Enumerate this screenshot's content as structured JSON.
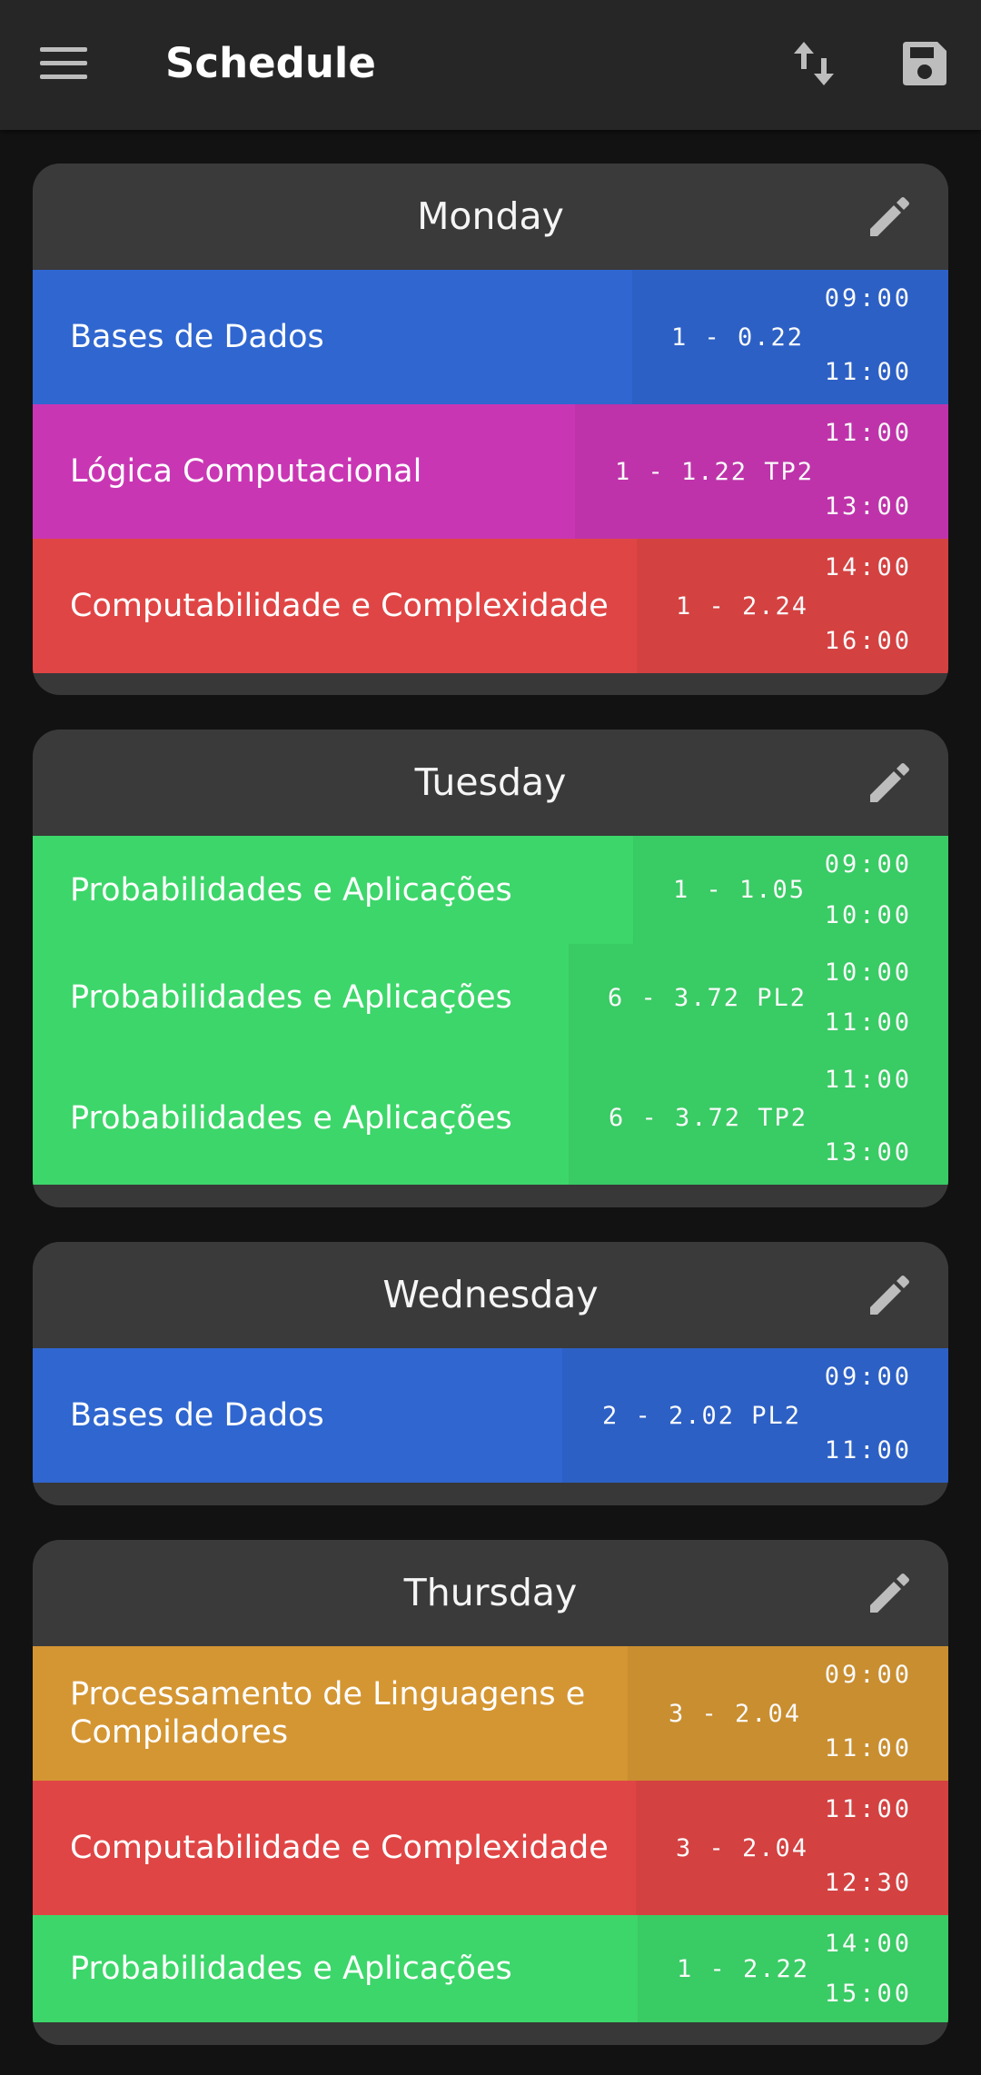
{
  "appbar": {
    "title": "Schedule",
    "menu_icon": "menu-icon",
    "sort_icon": "swap-vertical-icon",
    "save_icon": "save-icon"
  },
  "colors": {
    "blue": "#2f66d0",
    "magenta": "#c936b4",
    "red": "#e04545",
    "green": "#3dd66a",
    "orange": "#d49633"
  },
  "days": [
    {
      "name": "Monday",
      "lessons": [
        {
          "subject": "Bases de Dados",
          "room": "1 - 0.22",
          "start": "09:00",
          "end": "11:00"
        },
        {
          "subject": "Lógica Computacional",
          "room": "1 - 1.22 TP2",
          "start": "11:00",
          "end": "13:00"
        },
        {
          "subject": "Computabilidade e Complexidade",
          "room": "1 - 2.24",
          "start": "14:00",
          "end": "16:00"
        }
      ]
    },
    {
      "name": "Tuesday",
      "lessons": [
        {
          "subject": "Probabilidades e Aplicações",
          "room": "1 - 1.05",
          "start": "09:00",
          "end": "10:00"
        },
        {
          "subject": "Probabilidades e Aplicações",
          "room": "6 - 3.72 PL2",
          "start": "10:00",
          "end": "11:00"
        },
        {
          "subject": "Probabilidades e Aplicações",
          "room": "6 - 3.72 TP2",
          "start": "11:00",
          "end": "13:00"
        }
      ]
    },
    {
      "name": "Wednesday",
      "lessons": [
        {
          "subject": "Bases de Dados",
          "room": "2 - 2.02 PL2",
          "start": "09:00",
          "end": "11:00"
        }
      ]
    },
    {
      "name": "Thursday",
      "lessons": [
        {
          "subject": "Processamento de Linguagens e Compiladores",
          "room": "3 - 2.04",
          "start": "09:00",
          "end": "11:00"
        },
        {
          "subject": "Computabilidade e Complexidade",
          "room": "3 - 2.04",
          "start": "11:00",
          "end": "12:30"
        },
        {
          "subject": "Probabilidades e Aplicações",
          "room": "1 - 2.22",
          "start": "14:00",
          "end": "15:00"
        }
      ]
    }
  ]
}
